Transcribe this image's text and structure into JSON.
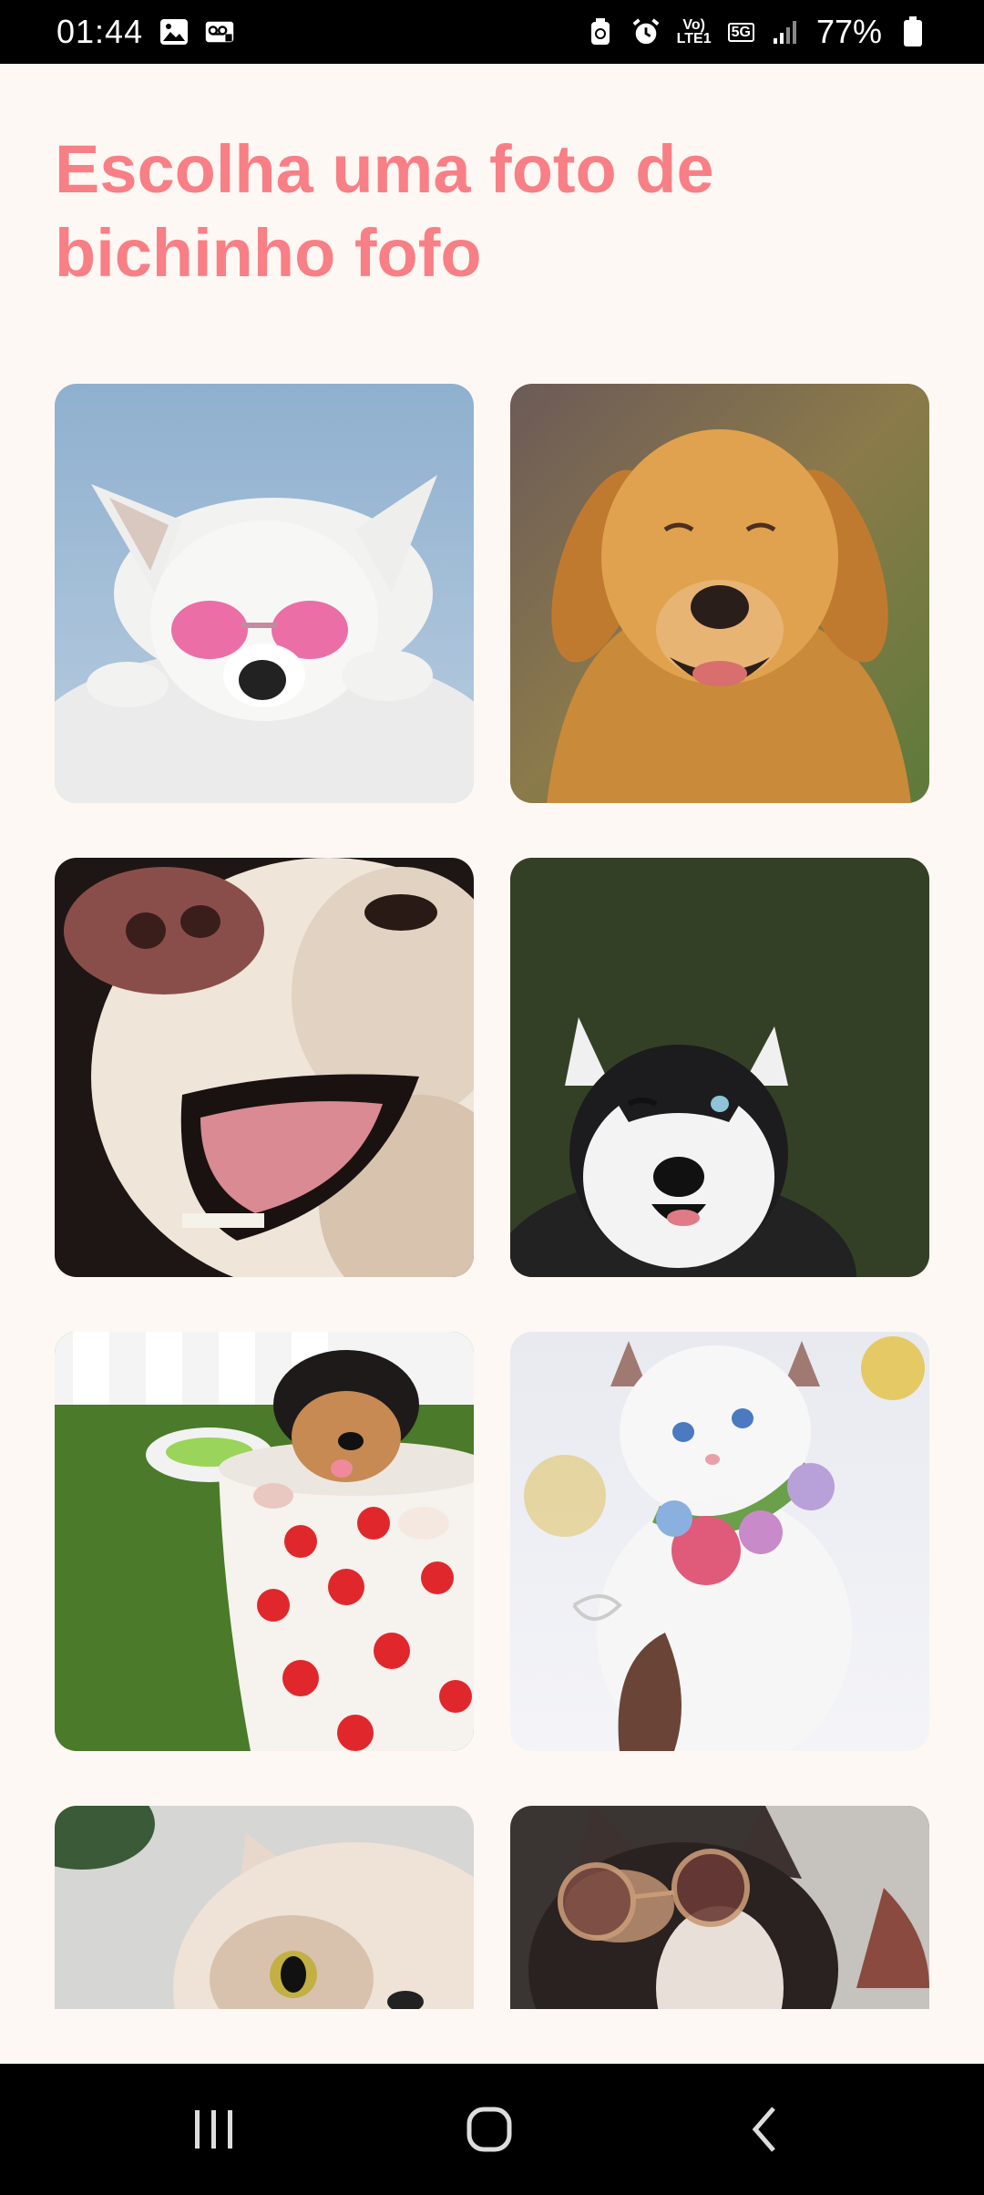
{
  "status_bar": {
    "time": "01:44",
    "battery_percent": "77%",
    "network_volte": "Vo)\nLTE1",
    "network_5g": "5G",
    "icons": [
      "gallery-icon",
      "voicemail-icon",
      "recycle-icon",
      "alarm-icon",
      "volte-icon",
      "5g-icon",
      "signal-icon",
      "battery-icon"
    ]
  },
  "page": {
    "title": "Escolha uma foto de bichinho fofo"
  },
  "photos": [
    {
      "subject": "white-dog-pink-heart-sunglasses"
    },
    {
      "subject": "golden-retriever"
    },
    {
      "subject": "dog-nose-closeup"
    },
    {
      "subject": "winking-husky"
    },
    {
      "subject": "puppy-in-polka-dot-cup"
    },
    {
      "subject": "white-kitten-flower-collar"
    },
    {
      "subject": "cat-closeup"
    },
    {
      "subject": "cat-with-round-glasses"
    }
  ],
  "nav_bar": {
    "buttons": [
      "recent-apps",
      "home",
      "back"
    ]
  },
  "colors": {
    "accent": "#f87f85",
    "background": "#fdf8f4",
    "bars": "#000000"
  }
}
